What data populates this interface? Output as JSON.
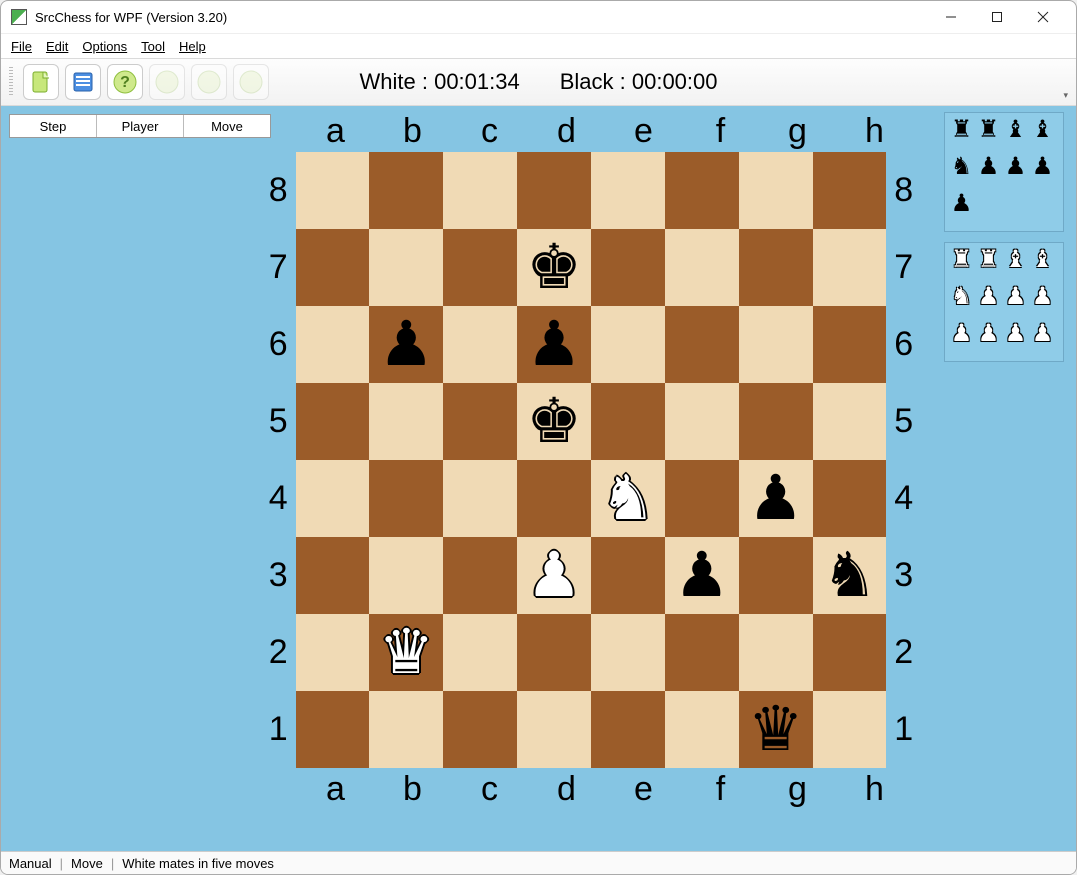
{
  "window_title": "SrcChess for WPF (Version 3.20)",
  "menu": [
    "File",
    "Edit",
    "Options",
    "Tool",
    "Help"
  ],
  "timers": {
    "white_label": "White : ",
    "white_time": "00:01:34",
    "black_label": "Black : ",
    "black_time": "00:00:00"
  },
  "move_grid_headers": [
    "Step",
    "Player",
    "Move"
  ],
  "board": {
    "files": [
      "a",
      "b",
      "c",
      "d",
      "e",
      "f",
      "g",
      "h"
    ],
    "ranks": [
      "8",
      "7",
      "6",
      "5",
      "4",
      "3",
      "2",
      "1"
    ],
    "pieces": [
      {
        "sq": "d7",
        "glyph": "♚",
        "color": "black"
      },
      {
        "sq": "b6",
        "glyph": "♟",
        "color": "black"
      },
      {
        "sq": "d6",
        "glyph": "♟",
        "color": "black"
      },
      {
        "sq": "d5",
        "glyph": "♚",
        "color": "black"
      },
      {
        "sq": "e4",
        "glyph": "♞",
        "color": "white"
      },
      {
        "sq": "g4",
        "glyph": "♟",
        "color": "black"
      },
      {
        "sq": "d3",
        "glyph": "♟",
        "color": "white"
      },
      {
        "sq": "f3",
        "glyph": "♟",
        "color": "black"
      },
      {
        "sq": "h3",
        "glyph": "♞",
        "color": "black"
      },
      {
        "sq": "b2",
        "glyph": "♛",
        "color": "white"
      },
      {
        "sq": "g1",
        "glyph": "♛",
        "color": "black"
      }
    ]
  },
  "captured": {
    "black": [
      "♜",
      "♜",
      "♝",
      "♝",
      "♞",
      "♟",
      "♟",
      "♟",
      "♟"
    ],
    "white": [
      "♜",
      "♜",
      "♝",
      "♝",
      "♞",
      "♟",
      "♟",
      "♟",
      "♟",
      "♟",
      "♟",
      "♟"
    ]
  },
  "status": {
    "mode": "Manual",
    "phase": "Move",
    "message": "White mates in five moves"
  },
  "colors": {
    "sky": "#85C5E3",
    "light_square": "#F0DAB5",
    "dark_square": "#9B5C29"
  }
}
